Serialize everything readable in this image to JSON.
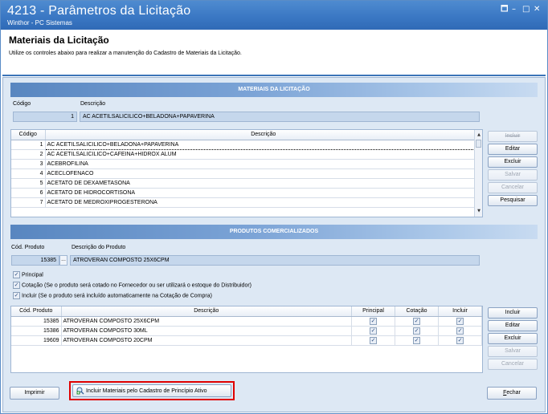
{
  "window": {
    "title": "4213 - Parâmetros da Licitação",
    "subtitle": "Winthor - PC Sistemas",
    "controls": [
      "🗖",
      "–",
      "□",
      "✕"
    ]
  },
  "header": {
    "title": "Materiais da Licitação",
    "description": "Utilize os controles abaixo para realizar a manutenção do Cadastro de Materiais da Licitação."
  },
  "materiais": {
    "section_title": "MATERIAIS DA LICITAÇÃO",
    "codigo_label": "Código",
    "descricao_label": "Descrição",
    "codigo_value": "1",
    "descricao_value": "AC ACETILSALICILICO+BELADONA+PAPAVERINA",
    "columns": [
      "Código",
      "Descrição"
    ],
    "rows": [
      {
        "codigo": "1",
        "descricao": "AC ACETILSALICILICO+BELADONA+PAPAVERINA"
      },
      {
        "codigo": "2",
        "descricao": "AC ACETILSALICILICO+CAFEINA+HIDROX ALUM"
      },
      {
        "codigo": "3",
        "descricao": "ACEBROFILINA"
      },
      {
        "codigo": "4",
        "descricao": "ACECLOFENACO"
      },
      {
        "codigo": "5",
        "descricao": "ACETATO DE DEXAMETASONA"
      },
      {
        "codigo": "6",
        "descricao": "ACETATO DE HIDROCORTISONA"
      },
      {
        "codigo": "7",
        "descricao": "ACETATO DE MEDROXIPROGESTERONA"
      }
    ],
    "buttons": {
      "incluir": "Incluir",
      "editar": "Editar",
      "excluir": "Excluir",
      "salvar": "Salvar",
      "cancelar": "Cancelar",
      "pesquisar": "Pesquisar"
    }
  },
  "produtos": {
    "section_title": "PRODUTOS COMERCIALIZADOS",
    "cod_label": "Cód. Produto",
    "desc_label": "Descrição do Produto",
    "cod_value": "15385",
    "desc_value": "ATROVERAN COMPOSTO 25X6CPM",
    "ellipsis": "...",
    "checks": {
      "principal": "Principal",
      "cotacao": "Cotação (Se o produto será cotado no Fornecedor ou ser utilizará o estoque do Distribuidor)",
      "incluir": "Incluir    (Se o produto será incluído automaticamente na Cotação de Compra)"
    },
    "columns": [
      "Cód. Produto",
      "Descrição",
      "Principal",
      "Cotação",
      "Incluir"
    ],
    "rows": [
      {
        "codigo": "15385",
        "descricao": "ATROVERAN COMPOSTO 25X6CPM"
      },
      {
        "codigo": "15386",
        "descricao": "ATROVERAN COMPOSTO 30ML"
      },
      {
        "codigo": "19609",
        "descricao": "ATROVERAN COMPOSTO 20CPM"
      }
    ],
    "check_mark": "✓",
    "buttons": {
      "incluir": "Incluir",
      "editar": "Editar",
      "excluir": "Excluir",
      "salvar": "Salvar",
      "cancelar": "Cancelar"
    }
  },
  "footer": {
    "imprimir": "Imprimir",
    "incluir_materiais": "Incluir Materiais pelo Cadastro de Princípio Ativo",
    "fechar_prefix": "F",
    "fechar_rest": "echar"
  },
  "colors": {
    "titlebar": "#3b78c4",
    "highlight": "#e00000",
    "panel": "#dde8f4"
  }
}
